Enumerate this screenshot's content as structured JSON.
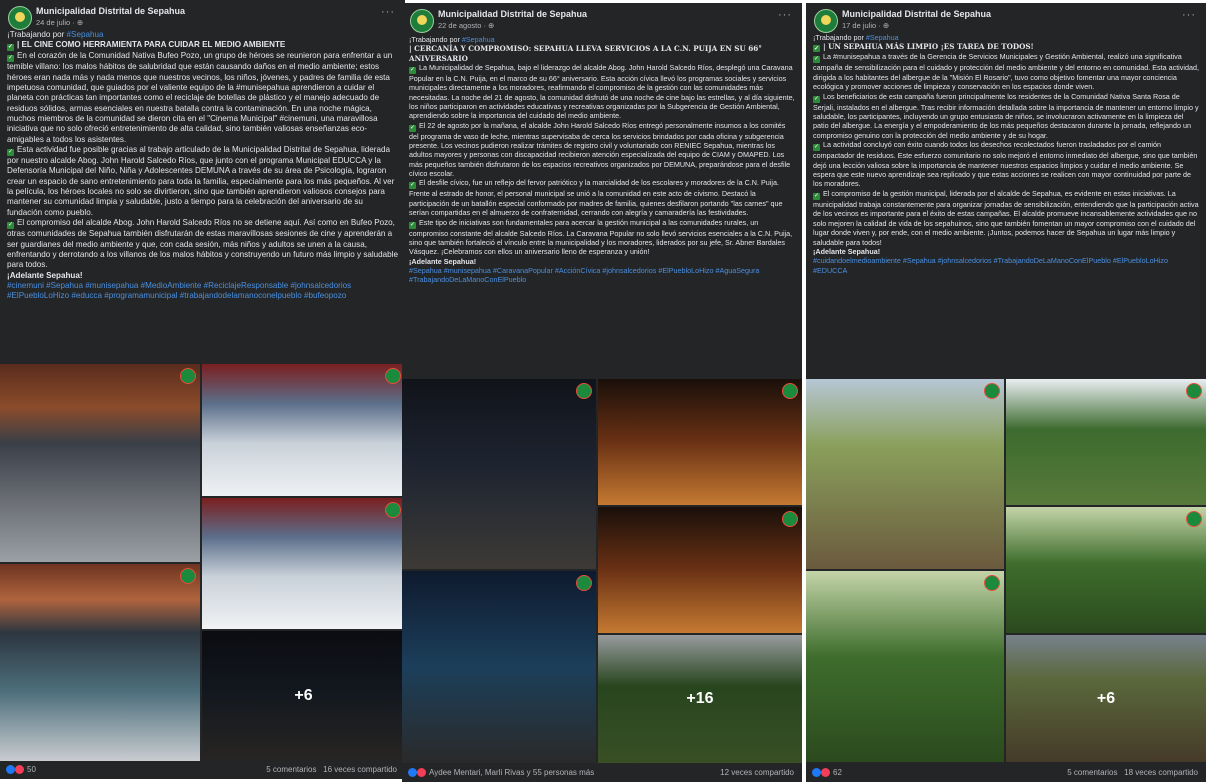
{
  "posts": [
    {
      "page_name": "Municipalidad Distrital de Sepahua",
      "date": "24 de julio · ",
      "working": "¡Trabajando por",
      "working_tag": "#Sepahua",
      "title": "| EL CINE COMO HERRAMIENTA PARA CUIDAR EL MEDIO AMBIENTE",
      "paragraphs": [
        "En el corazón de la Comunidad Nativa Bufeo Pozo, un grupo de héroes se reunieron para enfrentar a un temible villano: los malos hábitos de salubridad que están causando daños en el medio ambiente; estos héroes eran nada más y nada menos que nuestros vecinos, los niños, jóvenes, y padres de familia de esta impetuosa comunidad, que guiados por el valiente equipo de la #munisepahua aprendieron a cuidar el planeta con prácticas tan importantes como el reciclaje de botellas de plástico y el manejo adecuado de residuos sólidos, armas esenciales en nuestra batalla contra la contaminación. En una noche mágica, muchos miembros de la comunidad se dieron cita en el \"Cinema Municipal\" #cinemuni, una maravillosa iniciativa que no solo ofreció entretenimiento de alta calidad, sino también valiosas enseñanzas eco-amigables a todos los asistentes.",
        "Esta actividad fue posible gracias al trabajo articulado de la Municipalidad Distrital de Sepahua, liderada por nuestro alcalde Abog. John Harold Salcedo Ríos, que junto con el programa Municipal EDUCCA y la Defensoría Municipal del Niño, Niña y Adolescentes DEMUNA a través de su área de Psicología, lograron crear un espacio de sano entretenimiento para toda la familia, especialmente para los más pequeños. Al ver la película, los héroes locales no solo se divirtieron, sino que también aprendieron valiosos consejos para mantener su comunidad limpia y saludable, justo a tiempo para la celebración del aniversario de su fundación como pueblo.",
        "El compromiso del alcalde Abog. John Harold Salcedo Ríos no se detiene aquí. Así como en Bufeo Pozo, otras comunidades de Sepahua también disfrutarán de estas maravillosas sesiones de cine y aprenderán a ser guardianes del medio ambiente y que, con cada sesión, más niños y adultos se unen a la causa, enfrentando y derrotando a los villanos de los malos hábitos y construyendo un futuro más limpio y saludable para todos."
      ],
      "closing": "¡Adelante Sepahua!",
      "hashtags": "#cinemuni #Sepahua #munisepahua #MedioAmbiente #ReciclajeResponsable #johnsalcedorios #ElPuebloLoHizo #educca #programamunicipal #trabajandodelamanoconelpueblo #bufeopozo",
      "more": "+6",
      "reactions": "50",
      "comments": "5 comentarios",
      "shares": "16 veces compartido"
    },
    {
      "page_name": "Municipalidad Distrital de Sepahua",
      "date": "22 de agosto · ",
      "working": "¡Trabajando por",
      "working_tag": "#Sepahua",
      "title": "| CERCANÍA Y COMPROMISO: SEPAHUA LLEVA SERVICIOS A LA C.N. PUIJA EN SU 66° ANIVERSARIO",
      "paragraphs": [
        "La Municipalidad de Sepahua, bajo el liderazgo del alcalde Abog. John Harold Salcedo Ríos, desplegó una Caravana Popular en la C.N. Puija, en el marco de su 66° aniversario. Esta acción cívica llevó los programas sociales y servicios municipales directamente a los moradores, reafirmando el compromiso de la gestión con las comunidades más necesitadas. La noche del 21 de agosto, la comunidad disfrutó de una noche de cine bajo las estrellas, y al día siguiente, los niños participaron en actividades educativas y recreativas organizadas por la Subgerencia de Gestión Ambiental, aprendiendo sobre la importancia del cuidado del medio ambiente.",
        "El 22 de agosto por la mañana, el alcalde John Harold Salcedo Ríos entregó personalmente insumos a los comités del programa de vaso de leche, mientras supervisaba de cerca los servicios brindados por cada oficina y subgerencia presente. Los vecinos pudieron realizar trámites de registro civil y voluntariado con RENIEC Sepahua, mientras los adultos mayores y personas con discapacidad recibieron atención especializada del equipo de CIAM y OMAPED. Los más pequeños también disfrutaron de los espacios recreativos organizados por DEMUNA, preparándose para el desfile cívico escolar.",
        "El desfile cívico, fue un reflejo del fervor patriótico y la marcialidad de los escolares y moradores de la C.N. Puija. Frente al estrado de honor, el personal municipal se unió a la comunidad en este acto de civismo. Destacó la participación de un batallón especial conformado por madres de familia, quienes desfilaron portando \"las carnes\" que serían compartidas en el almuerzo de confraternidad, cerrando con alegría y camaradería las festividades.",
        "Este tipo de iniciativas son fundamentales para acercar la gestión municipal a las comunidades rurales, un compromiso constante del alcalde Salcedo Ríos. La Caravana Popular no solo llevó servicios esenciales a la C.N. Puija, sino que también fortaleció el vínculo entre la municipalidad y los moradores, liderados por su jefe, Sr. Abner Bardales Vásquez. ¡Celebramos con ellos un aniversario lleno de esperanza y unión!"
      ],
      "closing": "¡Adelante Sepahua!",
      "hashtags": "#Sepahua #munisepahua #CaravanaPopular #AcciónCívica #johnsalcedorios #ElPuebloLoHizo #AguaSegura #TrabajandoDeLaManoConElPueblo",
      "more": "+16",
      "reactions": "Aydee Mentari, Marli Rivas y 55 personas más",
      "comments": "",
      "shares": "12 veces compartido"
    },
    {
      "page_name": "Municipalidad Distrital de Sepahua",
      "date": "17 de julio · ",
      "working": "¡Trabajando por",
      "working_tag": "#Sepahua",
      "title": "| UN SEPAHUA MÁS LIMPIO ¡ES TAREA DE TODOS!",
      "paragraphs": [
        "La #munisepahua a través de la Gerencia de Servicios Municipales y Gestión Ambiental, realizó una significativa campaña de sensibilización para el cuidado y protección del medio ambiente y del entorno en comunidad. Esta actividad, dirigida a los habitantes del albergue de la \"Misión El Rosario\", tuvo como objetivo fomentar una mayor conciencia ecológica y promover acciones de limpieza y conservación en los espacios donde viven.",
        "Los beneficiarios de esta campaña fueron principalmente los residentes de la Comunidad Nativa Santa Rosa de Serjali, instalados en el albergue. Tras recibir información detallada sobre la importancia de mantener un entorno limpio y saludable, los participantes, incluyendo un grupo entusiasta de niños, se involucraron activamente en la limpieza del patio del albergue. La energía y el empoderamiento de los más pequeños destacaron durante la jornada, reflejando un compromiso genuino con la protección del medio ambiente y de su hogar.",
        "La actividad concluyó con éxito cuando todos los desechos recolectados fueron trasladados por el camión compactador de residuos. Este esfuerzo comunitario no solo mejoró el entorno inmediato del albergue, sino que también dejó una lección valiosa sobre la importancia de mantener nuestros espacios limpios y cuidar el medio ambiente. Se espera que este nuevo aprendizaje sea replicado y que estas acciones se realicen con mayor continuidad por parte de los moradores.",
        "El compromiso de la gestión municipal, liderada por el alcalde de Sepahua, es evidente en estas iniciativas. La municipalidad trabaja constantemente para organizar jornadas de sensibilización, entendiendo que la participación activa de los vecinos es importante para el éxito de estas campañas. El alcalde promueve incansablemente actividades que no solo mejoren la calidad de vida de los sepahuinos, sino que también fomentan un mayor compromiso con el cuidado del lugar donde viven y, por ende, con el medio ambiente. ¡Juntos, podemos hacer de Sepahua un lugar más limpio y saludable para todos!"
      ],
      "closing": "¡Adelante Sepahua!",
      "hashtags": "#cuidandoelmedioambiente #Sepahua #johnsalcedorios #TrabajandoDeLaManoConElPueblo #ElPuebloLoHizo #EDUCCA",
      "more": "+6",
      "reactions": "62",
      "comments": "5 comentarios",
      "shares": "18 veces compartido"
    }
  ],
  "icons": [
    "more-options-icon",
    "globe-icon",
    "check-icon",
    "like-icon",
    "love-icon",
    "muni-logo-icon"
  ],
  "colors": {
    "card_bg": "#242526",
    "link": "#4a90e2",
    "check": "#2e8b3a",
    "text": "#e4e6eb",
    "muted": "#b0b3b8"
  }
}
